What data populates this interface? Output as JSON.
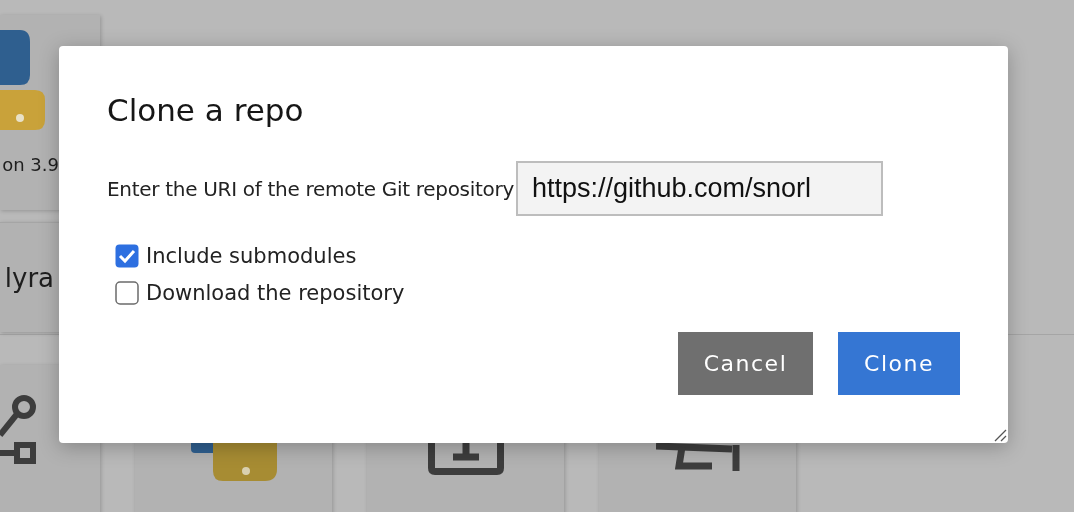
{
  "background": {
    "tiles": [
      {
        "label": "on 3.9"
      },
      {
        "label": "lyra"
      }
    ]
  },
  "dialog": {
    "title": "Clone a repo",
    "prompt": "Enter the URI of the remote Git repository",
    "url": "https://github.com/snorl",
    "options": [
      {
        "label": "Include submodules",
        "checked": true
      },
      {
        "label": "Download the repository",
        "checked": false
      }
    ],
    "buttons": [
      {
        "label": "Cancel",
        "kind": "secondary"
      },
      {
        "label": "Clone",
        "kind": "primary"
      }
    ]
  }
}
